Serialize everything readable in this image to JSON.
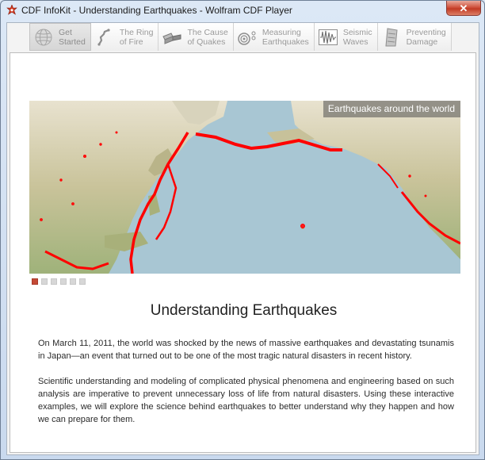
{
  "window": {
    "title": "CDF InfoKit - Understanding Earthquakes - Wolfram CDF Player",
    "close_symbol": "✕"
  },
  "tabs": [
    {
      "label": "Get\nStarted",
      "icon": "globe-icon",
      "active": true
    },
    {
      "label": "The Ring\nof Fire",
      "icon": "ring-of-fire-icon",
      "active": false
    },
    {
      "label": "The Cause\nof Quakes",
      "icon": "fault-block-icon",
      "active": false
    },
    {
      "label": "Measuring\nEarthquakes",
      "icon": "seismometer-icon",
      "active": false
    },
    {
      "label": "Seismic\nWaves",
      "icon": "wave-icon",
      "active": false
    },
    {
      "label": "Preventing\nDamage",
      "icon": "building-icon",
      "active": false
    }
  ],
  "map": {
    "caption": "Earthquakes around the world",
    "quake_color": "#ff0000"
  },
  "pager": {
    "count": 6,
    "active_index": 0
  },
  "article": {
    "heading": "Understanding Earthquakes",
    "paragraph1": "On March 11, 2011, the world was shocked by the news of massive earthquakes and devastating tsunamis in Japan—an event that turned out to be one of the most tragic natural disasters in recent history.",
    "paragraph2": "Scientific understanding and modeling of complicated physical phenomena and engineering based on such analysis are imperative to prevent unnecessary loss of life from natural disasters. Using these interactive examples, we will explore the science behind earthquakes to better understand why they happen and how we can prepare for them."
  },
  "colors": {
    "accent": "#c44a35",
    "close_button": "#c23a24"
  }
}
